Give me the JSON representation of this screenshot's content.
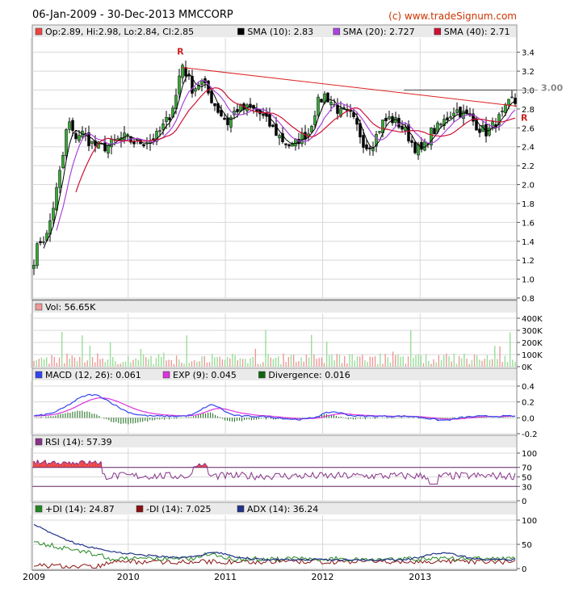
{
  "header": {
    "range_title": "06-Jan-2009 - 30-Dec-2013 MMCCORP",
    "copyright": "(c) www.tradeSignum.com"
  },
  "colors": {
    "panel_bg": "#ffffff",
    "grid": "#d8d8d8",
    "legend_bg": "#eaeaea",
    "candle_up": "#33aa33",
    "candle_down": "#000000",
    "sma10": "#000000",
    "sma20": "#aa44dd",
    "sma40": "#cc1133",
    "trendline": "#dd2222",
    "macd": "#3344ee",
    "exp": "#dd33dd",
    "divergence": "#116611",
    "rsi": "#883388",
    "rsi_fill": "#ee4444",
    "plus_di": "#228822",
    "minus_di": "#881111",
    "adx": "#223388"
  },
  "x_axis": {
    "ticks": [
      "2009",
      "2010",
      "2011",
      "2012",
      "2013"
    ]
  },
  "chart_data": [
    {
      "type": "candlestick",
      "title": "",
      "legend": [
        {
          "label": "Op:2.89, Hi:2.98, Lo:2.84, Cl:2.85",
          "color": "#ee4444"
        },
        {
          "label": "SMA (10): 2.83",
          "color": "#000000"
        },
        {
          "label": "SMA (20): 2.727",
          "color": "#aa44dd"
        },
        {
          "label": "SMA (40): 2.71",
          "color": "#cc1133"
        }
      ],
      "ohlc_last": {
        "open": 2.89,
        "high": 2.98,
        "low": 2.84,
        "close": 2.85
      },
      "ylim": [
        0.8,
        3.5
      ],
      "yticks": [
        "3.4",
        "3.2",
        "3.0",
        "2.8",
        "2.6",
        "2.4",
        "2.2",
        "2.0",
        "1.8",
        "1.6",
        "1.4",
        "1.2",
        "1.0",
        "0.8"
      ],
      "price_points": [
        [
          "2009-01-06",
          1.15
        ],
        [
          "2009-02-01",
          1.4
        ],
        [
          "2009-03-01",
          1.45
        ],
        [
          "2009-04-01",
          1.85
        ],
        [
          "2009-05-01",
          2.3
        ],
        [
          "2009-05-20",
          2.7
        ],
        [
          "2009-06-10",
          2.5
        ],
        [
          "2009-07-10",
          2.55
        ],
        [
          "2009-08-10",
          2.45
        ],
        [
          "2009-09-10",
          2.4
        ],
        [
          "2009-10-10",
          2.4
        ],
        [
          "2009-11-10",
          2.45
        ],
        [
          "2009-12-15",
          2.5
        ],
        [
          "2010-01-20",
          2.45
        ],
        [
          "2010-03-01",
          2.45
        ],
        [
          "2010-04-15",
          2.5
        ],
        [
          "2010-06-01",
          2.7
        ],
        [
          "2010-07-01",
          2.95
        ],
        [
          "2010-07-20",
          3.3
        ],
        [
          "2010-08-10",
          3.15
        ],
        [
          "2010-09-01",
          3.0
        ],
        [
          "2010-10-01",
          3.1
        ],
        [
          "2010-11-01",
          2.95
        ],
        [
          "2010-12-01",
          2.8
        ],
        [
          "2011-01-10",
          2.65
        ],
        [
          "2011-02-10",
          2.8
        ],
        [
          "2011-03-10",
          2.8
        ],
        [
          "2011-04-10",
          2.8
        ],
        [
          "2011-05-10",
          2.75
        ],
        [
          "2011-06-10",
          2.65
        ],
        [
          "2011-07-10",
          2.55
        ],
        [
          "2011-08-10",
          2.45
        ],
        [
          "2011-09-10",
          2.4
        ],
        [
          "2011-10-10",
          2.5
        ],
        [
          "2011-11-10",
          2.55
        ],
        [
          "2011-12-10",
          2.85
        ],
        [
          "2012-01-10",
          2.95
        ],
        [
          "2012-02-10",
          2.85
        ],
        [
          "2012-03-10",
          2.75
        ],
        [
          "2012-04-10",
          2.75
        ],
        [
          "2012-05-10",
          2.6
        ],
        [
          "2012-06-10",
          2.4
        ],
        [
          "2012-07-10",
          2.45
        ],
        [
          "2012-08-10",
          2.65
        ],
        [
          "2012-09-10",
          2.7
        ],
        [
          "2012-10-10",
          2.65
        ],
        [
          "2012-11-10",
          2.55
        ],
        [
          "2012-12-10",
          2.4
        ],
        [
          "2013-01-10",
          2.35
        ],
        [
          "2013-02-10",
          2.55
        ],
        [
          "2013-03-10",
          2.6
        ],
        [
          "2013-04-10",
          2.7
        ],
        [
          "2013-05-10",
          2.8
        ],
        [
          "2013-06-10",
          2.75
        ],
        [
          "2013-07-10",
          2.7
        ],
        [
          "2013-08-10",
          2.6
        ],
        [
          "2013-09-10",
          2.55
        ],
        [
          "2013-10-10",
          2.65
        ],
        [
          "2013-11-10",
          2.75
        ],
        [
          "2013-12-10",
          2.9
        ],
        [
          "2013-12-30",
          2.85
        ]
      ],
      "annotations": [
        {
          "text": "R",
          "date": "2010-07-15",
          "value": 3.34
        },
        {
          "text": "R",
          "date": "2013-12-30",
          "value": 2.71
        },
        {
          "text": "3.00",
          "date": "2013-12-30",
          "value": 3.0
        }
      ],
      "trendline": [
        [
          "2010-07-20",
          3.24
        ],
        [
          "2013-12-30",
          2.83
        ]
      ],
      "resistance_level": {
        "start": "2012-11-01",
        "end": "2013-12-30",
        "value": 3.0
      }
    },
    {
      "type": "bar",
      "legend": [
        {
          "label": "Vol: 56.65K",
          "color": "#ee9999"
        }
      ],
      "ylim": [
        0,
        400000
      ],
      "yticks": [
        "400K",
        "300K",
        "200K",
        "100K",
        "0K"
      ]
    },
    {
      "type": "line",
      "legend": [
        {
          "label": "MACD (12, 26): 0.061",
          "color": "#3344ee"
        },
        {
          "label": "EXP (9): 0.045",
          "color": "#dd33dd"
        },
        {
          "label": "Divergence: 0.016",
          "color": "#116611"
        }
      ],
      "ylim": [
        -0.2,
        0.4
      ],
      "yticks": [
        "0.4",
        "0.2",
        "0.0",
        "-0.2"
      ]
    },
    {
      "type": "line",
      "legend": [
        {
          "label": "RSI (14): 57.39",
          "color": "#883388"
        }
      ],
      "ylim": [
        0,
        100
      ],
      "yticks": [
        "100",
        "70",
        "50",
        "30",
        "0"
      ],
      "levels": [
        70,
        30
      ]
    },
    {
      "type": "line",
      "legend": [
        {
          "label": "+DI (14): 24.87",
          "color": "#228822"
        },
        {
          "label": "-DI (14): 7.025",
          "color": "#881111"
        },
        {
          "label": "ADX (14): 36.24",
          "color": "#223388"
        }
      ],
      "ylim": [
        0,
        100
      ],
      "yticks": [
        "100",
        "50",
        "0"
      ]
    }
  ]
}
